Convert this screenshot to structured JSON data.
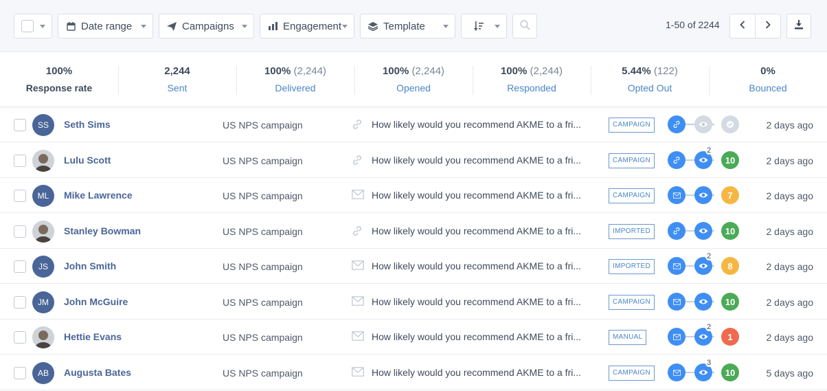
{
  "toolbar": {
    "filters": [
      {
        "label": "Date range",
        "icon": "calendar-icon"
      },
      {
        "label": "Campaigns",
        "icon": "send-icon"
      },
      {
        "label": "Engagement",
        "icon": "bar-chart-icon"
      },
      {
        "label": "Template",
        "icon": "layers-icon"
      }
    ],
    "pagination": "1-50 of 2244"
  },
  "stats": [
    {
      "value": "100%",
      "sub": "",
      "label": "Response rate"
    },
    {
      "value": "2,244",
      "sub": "",
      "label": "Sent"
    },
    {
      "value": "100%",
      "sub": "(2,244)",
      "label": "Delivered"
    },
    {
      "value": "100%",
      "sub": "(2,244)",
      "label": "Opened"
    },
    {
      "value": "100%",
      "sub": "(2,244)",
      "label": "Responded"
    },
    {
      "value": "5.44%",
      "sub": "(122)",
      "label": "Opted Out"
    },
    {
      "value": "0%",
      "sub": "",
      "label": "Bounced"
    }
  ],
  "rows": [
    {
      "initials": "SS",
      "photo": false,
      "name": "Seth Sims",
      "campaign": "US NPS campaign",
      "channel": "link",
      "message": "How likely would you recommend AKME to a fri...",
      "source": "CAMPAIGN",
      "sent_state": "blue",
      "opened": "gray",
      "open_count": "",
      "score": "",
      "score_color": "gray",
      "time": "2 days ago"
    },
    {
      "initials": "",
      "photo": true,
      "name": "Lulu Scott",
      "campaign": "US NPS campaign",
      "channel": "link",
      "message": "How likely would you recommend AKME to a fri...",
      "source": "CAMPAIGN",
      "sent_state": "blue",
      "opened": "blue",
      "open_count": "2",
      "score": "10",
      "score_color": "green",
      "time": "2 days ago"
    },
    {
      "initials": "ML",
      "photo": false,
      "name": "Mike Lawrence",
      "campaign": "US NPS campaign",
      "channel": "email",
      "message": "How likely would you recommend AKME to a fri...",
      "source": "CAMPAIGN",
      "sent_state": "blue",
      "opened": "blue",
      "open_count": "",
      "score": "7",
      "score_color": "amber",
      "time": "2 days ago"
    },
    {
      "initials": "",
      "photo": true,
      "name": "Stanley Bowman",
      "campaign": "US NPS campaign",
      "channel": "link",
      "message": "How likely would you recommend AKME to a fri...",
      "source": "IMPORTED",
      "sent_state": "blue",
      "opened": "blue",
      "open_count": "",
      "score": "10",
      "score_color": "green",
      "time": "2 days ago"
    },
    {
      "initials": "JS",
      "photo": false,
      "name": "John Smith",
      "campaign": "US NPS campaign",
      "channel": "email",
      "message": "How likely would you recommend AKME to a fri...",
      "source": "IMPORTED",
      "sent_state": "blue",
      "opened": "blue",
      "open_count": "2",
      "score": "8",
      "score_color": "amber",
      "time": "2 days ago"
    },
    {
      "initials": "JM",
      "photo": false,
      "name": "John McGuire",
      "campaign": "US NPS campaign",
      "channel": "email",
      "message": "How likely would you recommend AKME to a fri...",
      "source": "CAMPAIGN",
      "sent_state": "blue",
      "opened": "blue",
      "open_count": "",
      "score": "10",
      "score_color": "green",
      "time": "2 days ago"
    },
    {
      "initials": "",
      "photo": true,
      "name": "Hettie Evans",
      "campaign": "US NPS campaign",
      "channel": "email",
      "message": "How likely would you recommend AKME to a fri...",
      "source": "MANUAL",
      "sent_state": "blue",
      "opened": "blue",
      "open_count": "2",
      "score": "1",
      "score_color": "red",
      "time": "2 days ago"
    },
    {
      "initials": "AB",
      "photo": false,
      "name": "Augusta Bates",
      "campaign": "US NPS campaign",
      "channel": "email",
      "message": "How likely would you recommend AKME to a fri...",
      "source": "CAMPAIGN",
      "sent_state": "blue",
      "opened": "blue",
      "open_count": "3",
      "score": "10",
      "score_color": "green",
      "time": "5 days ago"
    }
  ]
}
